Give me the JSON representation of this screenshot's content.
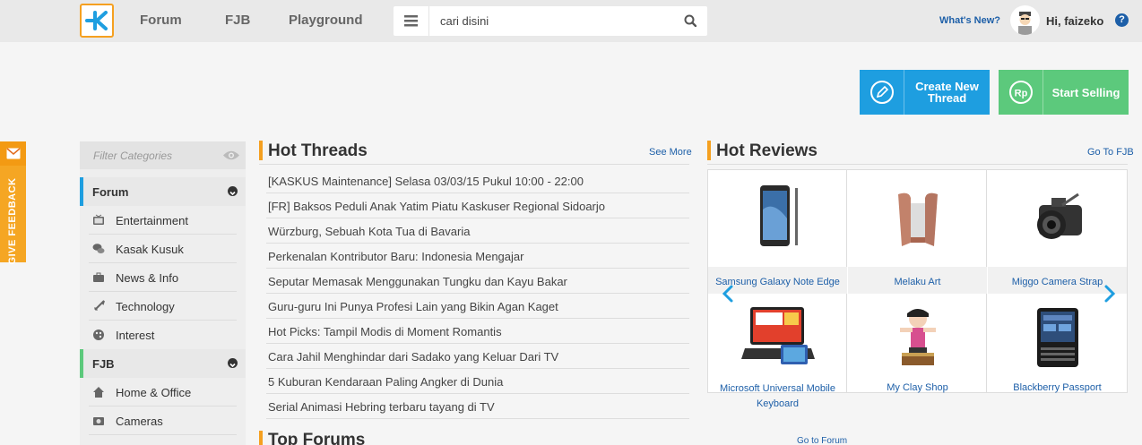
{
  "nav": {
    "forum": "Forum",
    "fjb": "FJB",
    "playground": "Playground"
  },
  "search": {
    "placeholder": "cari disini"
  },
  "user": {
    "whats_new": "What's New?",
    "greeting": "Hi, faizeko",
    "help": "?"
  },
  "actions": {
    "create_thread_line1": "Create New",
    "create_thread_line2": "Thread",
    "start_selling": "Start Selling"
  },
  "feedback": {
    "label": "GIVE FEEDBACK"
  },
  "sidebar": {
    "filter_placeholder": "Filter Categories",
    "forum_title": "Forum",
    "forum_items": [
      "Entertainment",
      "Kasak Kusuk",
      "News & Info",
      "Technology",
      "Interest"
    ],
    "fjb_title": "FJB",
    "fjb_items": [
      "Home & Office",
      "Cameras"
    ]
  },
  "hot_threads": {
    "title": "Hot Threads",
    "see_more": "See More",
    "items": [
      "[KASKUS Maintenance] Selasa 03/03/15 Pukul 10:00 - 22:00",
      "[FR] Baksos Peduli Anak Yatim Piatu Kaskuser Regional Sidoarjo",
      "Würzburg, Sebuah Kota Tua di Bavaria",
      "Perkenalan Kontributor Baru: Indonesia Mengajar",
      "Seputar Memasak Menggunakan Tungku dan Kayu Bakar",
      "Guru-guru Ini Punya Profesi Lain yang Bikin Agan Kaget",
      "Hot Picks: Tampil Modis di Moment Romantis",
      "Cara Jahil Menghindar dari Sadako yang Keluar Dari TV",
      "5 Kuburan Kendaraan Paling Angker di Dunia",
      "Serial Animasi Hebring terbaru tayang di TV"
    ]
  },
  "top_forums": {
    "title": "Top Forums"
  },
  "hot_reviews": {
    "title": "Hot Reviews",
    "go_fjb": "Go To FJB",
    "go_forum": "Go to Forum",
    "items": [
      {
        "name": "Samsung Galaxy Note Edge",
        "icon": "smartphone-stylus-icon"
      },
      {
        "name": "Melaku Art",
        "icon": "wooden-stand-icon"
      },
      {
        "name": "Miggo Camera Strap",
        "icon": "camera-icon"
      },
      {
        "name": "Microsoft Universal Mobile Keyboard",
        "icon": "tablet-keyboard-icon"
      },
      {
        "name": "My Clay Shop",
        "icon": "clay-figure-icon"
      },
      {
        "name": "Blackberry Passport",
        "icon": "blackberry-icon"
      }
    ]
  },
  "colors": {
    "accent_blue": "#1e9ee0",
    "accent_green": "#5cc97c",
    "accent_orange": "#f5a020",
    "link_blue": "#1d5fa8"
  }
}
